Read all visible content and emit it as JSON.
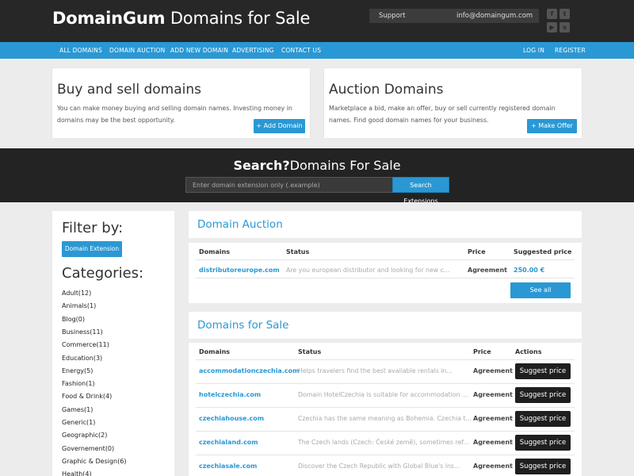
{
  "header": {
    "brand_bold": "DomainGum",
    "brand_rest": " Domains for Sale",
    "support_label": "Support",
    "support_email": "info@domaingum.com"
  },
  "nav": {
    "items": [
      "ALL DOMAINS",
      "DOMAIN AUCTION",
      "ADD NEW DOMAIN",
      "ADVERTISING",
      "CONTACT US"
    ],
    "login": "LOG IN",
    "register": "REGISTER"
  },
  "hero": {
    "buy": {
      "title": "Buy and sell domains",
      "text": "You can make money buying and selling domain names. Investing money in domains may be the best opportunity.",
      "button": "+ Add Domain"
    },
    "auction": {
      "title": "Auction Domains",
      "text": "Marketplace a bid, make an offer, buy or sell currently registered domain names. Find good domain names for your business.",
      "button": "+ Make Offer"
    }
  },
  "search": {
    "title_bold": "Search?",
    "title_rest": "Domains For Sale",
    "placeholder": "Enter domain extension only (.example)",
    "button": "Search Extensions"
  },
  "sidebar": {
    "filter_title": "Filter by:",
    "filter_button": "Domain Extension",
    "categories_title": "Categories:",
    "categories": [
      "Adult(12)",
      "Animals(1)",
      "Blog(0)",
      "Business(11)",
      "Commerce(11)",
      "Education(3)",
      "Energy(5)",
      "Fashion(1)",
      "Food & Drink(4)",
      "Games(1)",
      "Generic(1)",
      "Geographic(2)",
      "Governement(0)",
      "Graphic & Design(6)",
      "Health(4)"
    ]
  },
  "auction": {
    "title": "Domain Auction",
    "headers": [
      "Domains",
      "Status",
      "Price",
      "Suggested price"
    ],
    "rows": [
      {
        "domain": "distributoreurope.com",
        "status": "Are you european distributor and looking for new c...",
        "price": "Agreement",
        "suggested": "250.00 €"
      }
    ],
    "see_all": "See all"
  },
  "forsale": {
    "title": "Domains for Sale",
    "headers": [
      "Domains",
      "Status",
      "Price",
      "Actions"
    ],
    "rows": [
      {
        "domain": "accommodationczechia.com",
        "status": "Helps travelers find the best available rentals in...",
        "price": "Agreement",
        "action": "Suggest price"
      },
      {
        "domain": "hotelczechia.com",
        "status": "Domain HotelCzechia is suitable for accommodation ...",
        "price": "Agreement",
        "action": "Suggest price"
      },
      {
        "domain": "czechiahouse.com",
        "status": "Czechia has the same meaning as Bohemia. Czechia t...",
        "price": "Agreement",
        "action": "Suggest price"
      },
      {
        "domain": "czechialand.com",
        "status": "The Czech lands (Czech: České země), sometimes ref...",
        "price": "Agreement",
        "action": "Suggest price"
      },
      {
        "domain": "czechiasale.com",
        "status": "Discover the Czech Republic with Global Blue's ins...",
        "price": "Agreement",
        "action": "Suggest price"
      }
    ]
  },
  "icons": [
    "facebook-icon",
    "twitter-icon",
    "youtube-icon",
    "skype-icon"
  ],
  "colors": {
    "accent": "#2a98d4",
    "dark": "#272727",
    "background": "#ececec"
  }
}
